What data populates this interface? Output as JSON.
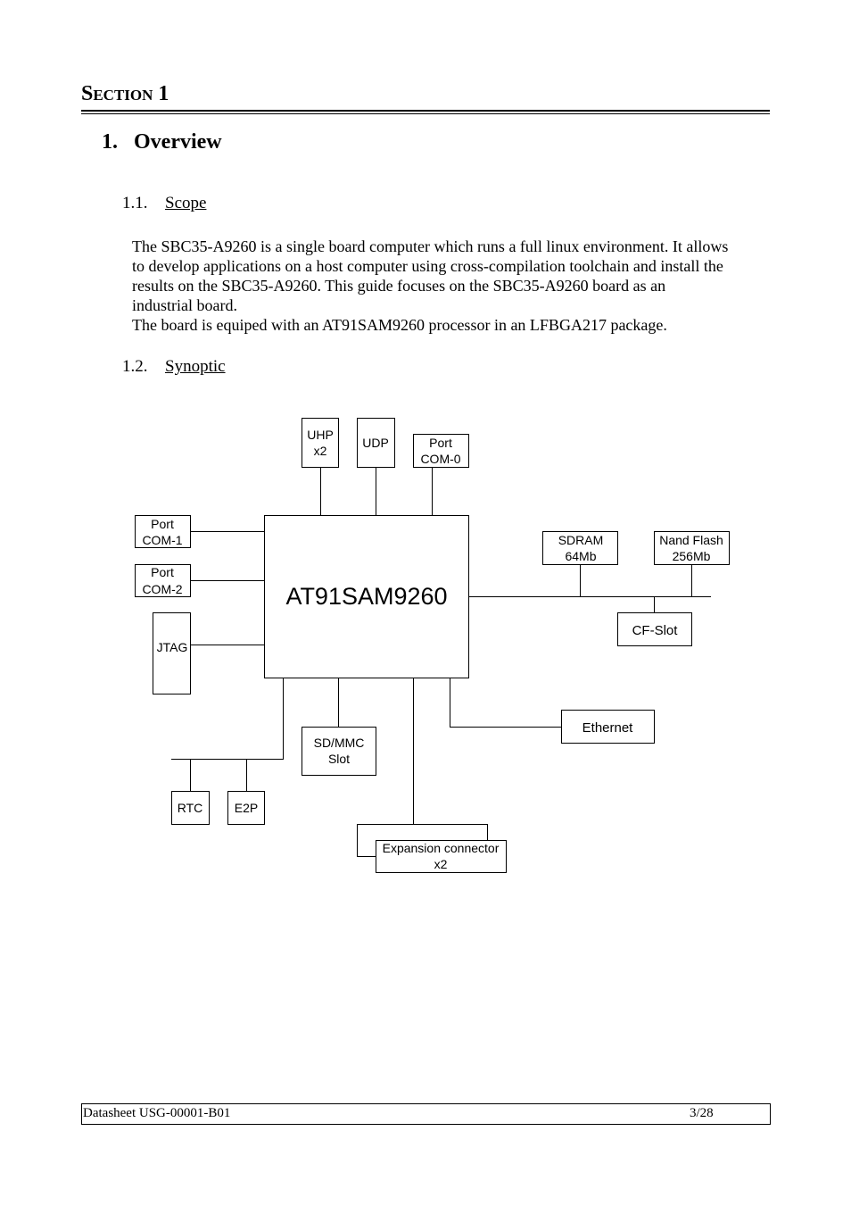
{
  "header": {
    "section_label": "Section 1"
  },
  "heading1": {
    "number": "1.",
    "title": "Overview"
  },
  "scope": {
    "number": "1.1.",
    "title": "Scope",
    "paragraph_lines": [
      "The SBC35-A9260 is a single board computer which runs a full linux environment. It allows",
      "to develop applications on a host computer using cross-compilation toolchain and install the",
      "results on the SBC35-A9260. This guide focuses on the SBC35-A9260 board as an",
      "industrial board.",
      "The board is equiped with an AT91SAM9260 processor in an LFBGA217 package."
    ]
  },
  "synoptic": {
    "number": "1.2.",
    "title": "Synoptic",
    "diagram": {
      "cpu": "AT91SAM9260",
      "blocks": {
        "uhp": [
          "UHP",
          "x2"
        ],
        "udp": [
          "UDP"
        ],
        "com0": [
          "Port",
          "COM-0"
        ],
        "com1": [
          "Port",
          "COM-1"
        ],
        "com2": [
          "Port",
          "COM-2"
        ],
        "jtag": [
          "JTAG"
        ],
        "sdram": [
          "SDRAM",
          "64Mb"
        ],
        "nand": [
          "Nand Flash",
          "256Mb"
        ],
        "cfslot": [
          "CF-Slot"
        ],
        "ethernet": [
          "Ethernet"
        ],
        "sdmmc": [
          "SD/MMC",
          "Slot"
        ],
        "rtc": [
          "RTC"
        ],
        "e2p": [
          "E2P"
        ],
        "expansion": [
          "Expansion connector",
          "x2"
        ]
      }
    }
  },
  "footer": {
    "document": "Datasheet USG-00001-B01",
    "page": "3/28"
  }
}
